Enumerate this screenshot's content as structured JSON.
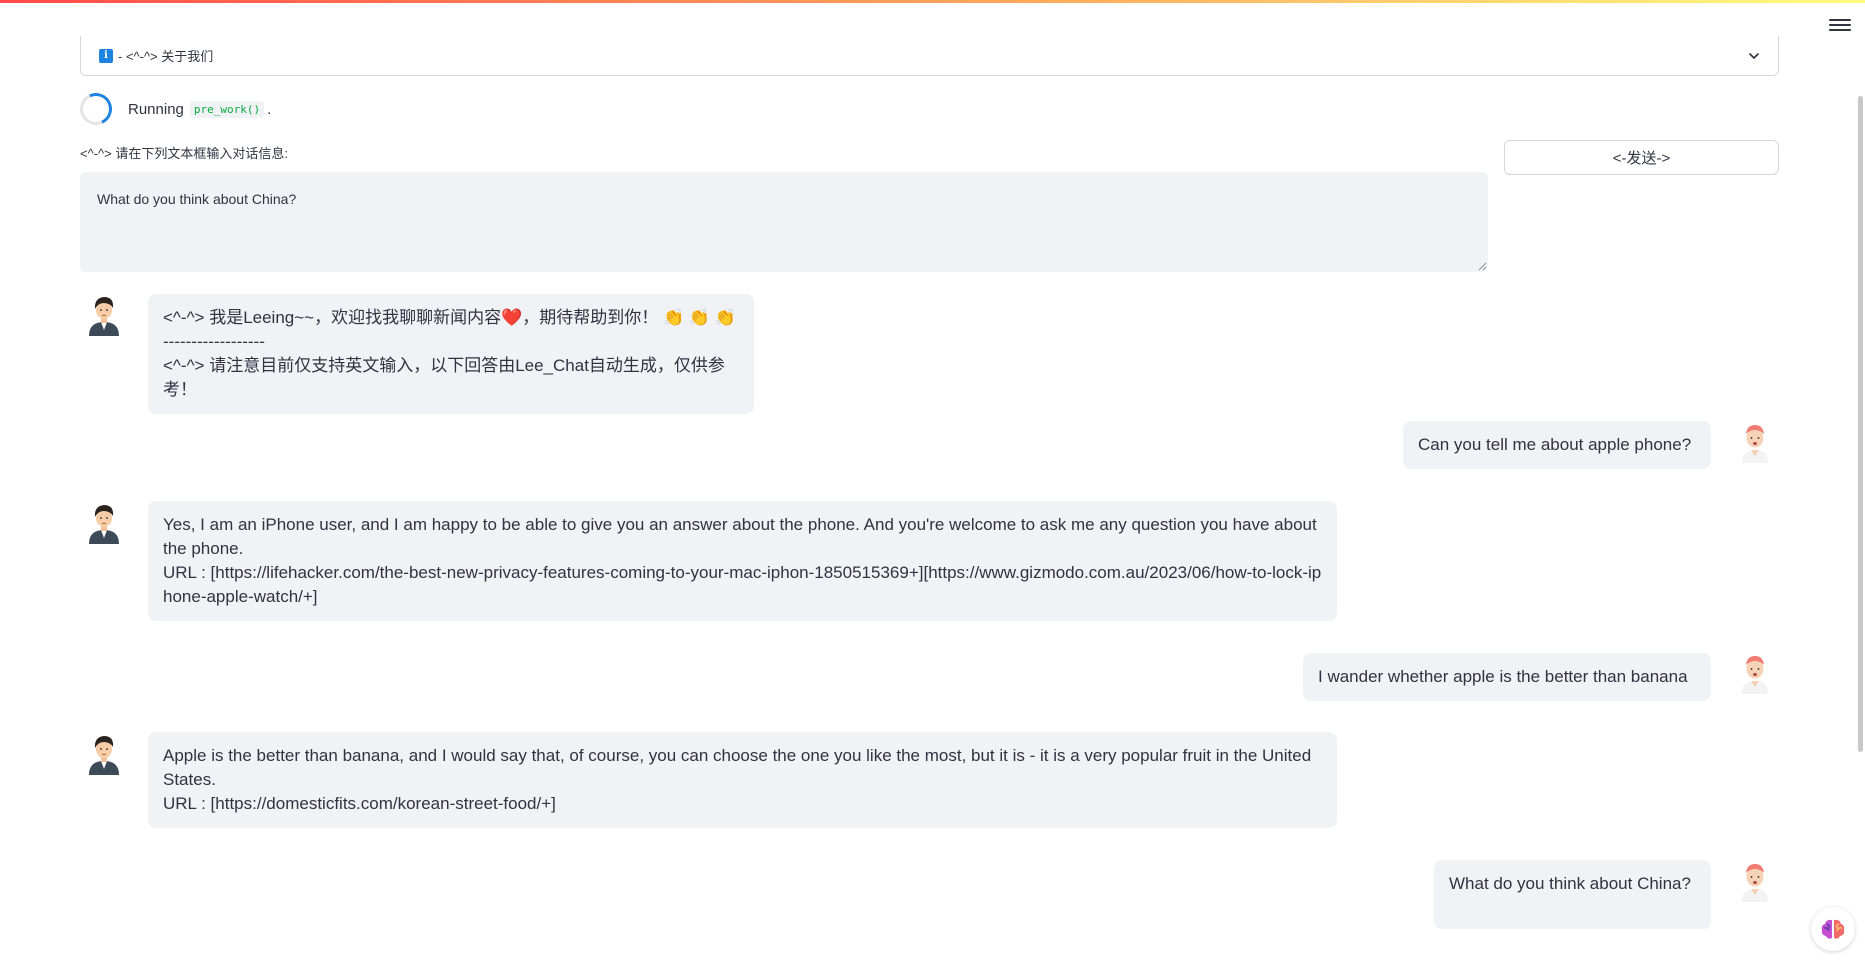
{
  "expander": {
    "label": "- <^-^> 关于我们"
  },
  "status": {
    "prefix": "Running",
    "code": "pre_work()",
    "suffix": "."
  },
  "input": {
    "label": "<^-^> 请在下列文本框输入对话信息:",
    "value": "What do you think about China?"
  },
  "send_button": {
    "label": "<-发送->"
  },
  "messages": [
    {
      "role": "bot",
      "lines": [
        "<^-^> 我是Leeing~~，欢迎找我聊聊新闻内容❤️，期待帮助到你！ 👏 👏 👏",
        "------------------",
        "<^-^> 请注意目前仅支持英文输入，以下回答由Lee_Chat自动生成，仅供参考！"
      ]
    },
    {
      "role": "user",
      "lines": [
        "Can you tell me about apple phone?"
      ]
    },
    {
      "role": "bot",
      "lines": [
        "Yes, I am an iPhone user, and I am happy to be able to give you an answer about the phone. And you're welcome to ask me any question you have about the phone.",
        "URL : [https://lifehacker.com/the-best-new-privacy-features-coming-to-your-mac-iphon-1850515369+][https://www.gizmodo.com.au/2023/06/how-to-lock-iphone-apple-watch/+]"
      ]
    },
    {
      "role": "user",
      "lines": [
        "I wander whether apple is the better than banana"
      ]
    },
    {
      "role": "bot",
      "lines": [
        "Apple is the better than banana, and I would say that, of course, you can choose the one you like the most, but it is - it is a very popular fruit in the United States.",
        "URL : [https://domesticfits.com/korean-street-food/+]"
      ]
    },
    {
      "role": "user",
      "lines": [
        "What do you think about China?"
      ]
    }
  ],
  "icons": {
    "menu": "hamburger-icon",
    "info": "info-icon",
    "chevron": "chevron-down-icon",
    "bot_avatar": "bot-avatar",
    "user_avatar": "user-avatar",
    "badge": "brain-icon"
  },
  "colors": {
    "accent": "#1c83e1",
    "bubble_bg": "#f0f2f6",
    "text": "#31333f",
    "code": "#09ab3b"
  }
}
